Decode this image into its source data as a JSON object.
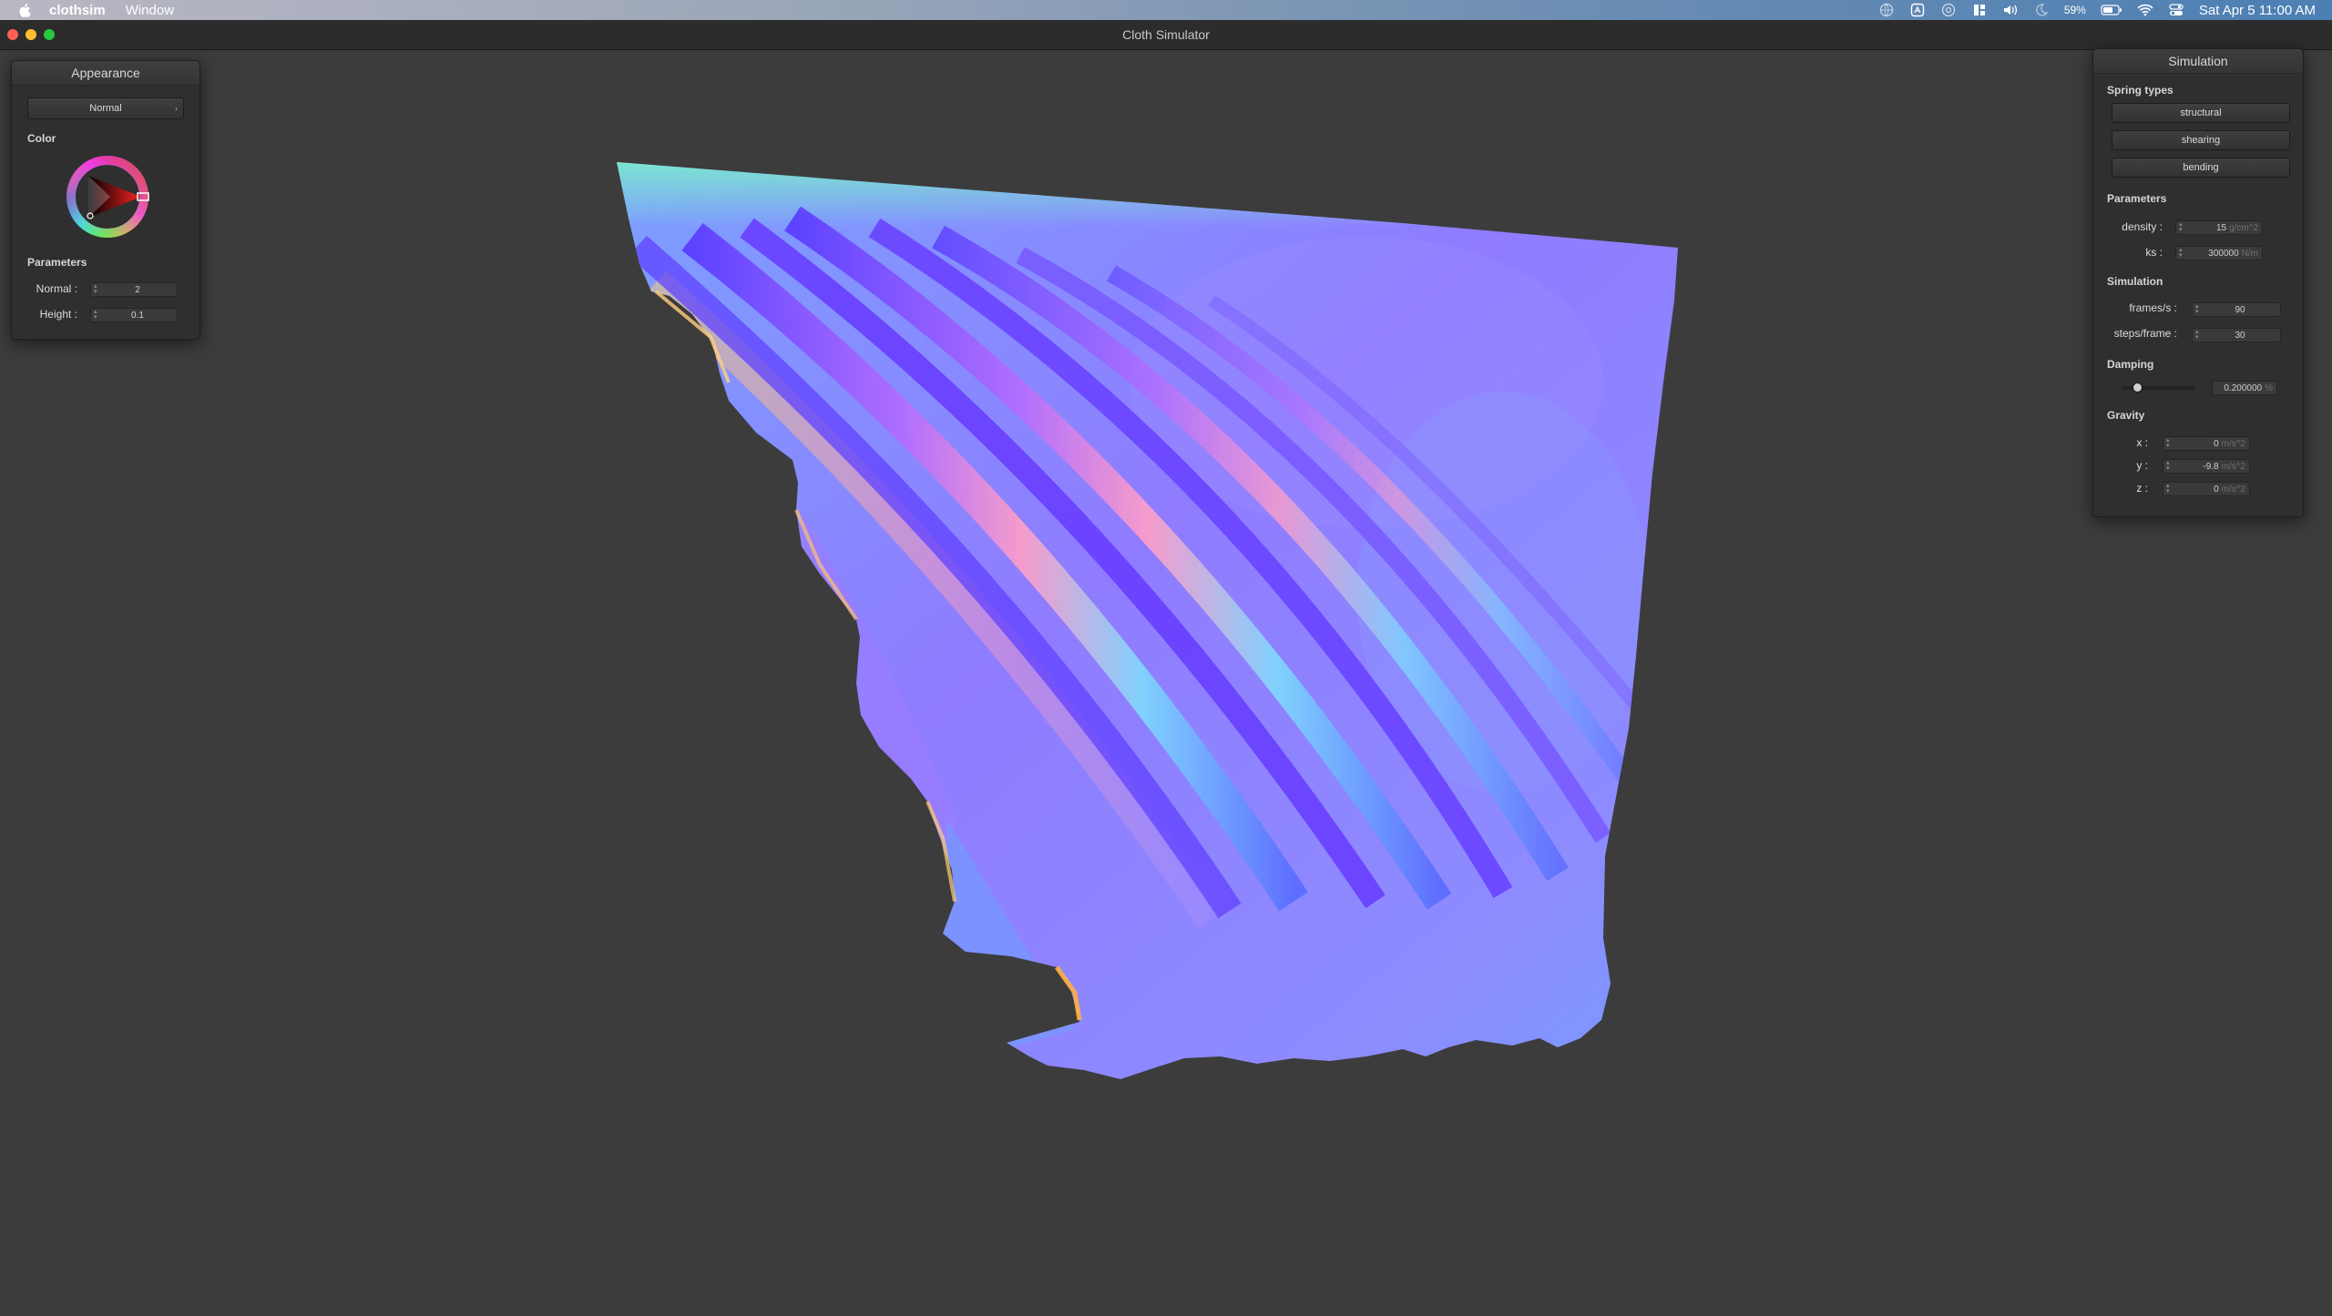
{
  "menubar": {
    "app_name": "clothsim",
    "menus": [
      "Window"
    ],
    "battery_percent": "59%",
    "clock": "Sat Apr 5  11:00 AM"
  },
  "window": {
    "title": "Cloth Simulator"
  },
  "appearance_panel": {
    "title": "Appearance",
    "shader_dropdown": "Normal",
    "color_label": "Color",
    "parameters_label": "Parameters",
    "normal_label": "Normal :",
    "normal_value": "2",
    "height_label": "Height :",
    "height_value": "0.1"
  },
  "simulation_panel": {
    "title": "Simulation",
    "spring_types_label": "Spring types",
    "spring_buttons": [
      "structural",
      "shearing",
      "bending"
    ],
    "parameters_label": "Parameters",
    "density_label": "density :",
    "density_value": "15",
    "density_unit": "g/cm^2",
    "ks_label": "ks :",
    "ks_value": "300000",
    "ks_unit": "N/m",
    "simulation_label": "Simulation",
    "fps_label": "frames/s :",
    "fps_value": "90",
    "steps_label": "steps/frame :",
    "steps_value": "30",
    "damping_label": "Damping",
    "damping_value": "0.200000",
    "damping_unit": "%",
    "damping_fraction": 0.2,
    "gravity_label": "Gravity",
    "gx_label": "x :",
    "gx_value": "0",
    "gy_label": "y :",
    "gy_value": "-9.8",
    "gz_label": "z :",
    "gz_value": "0",
    "gravity_unit": "m/s^2"
  },
  "colors": {
    "background": "#3c3c3c",
    "cloth_primary": "#8f7cff",
    "cloth_highlight": "#ffa0b8"
  }
}
